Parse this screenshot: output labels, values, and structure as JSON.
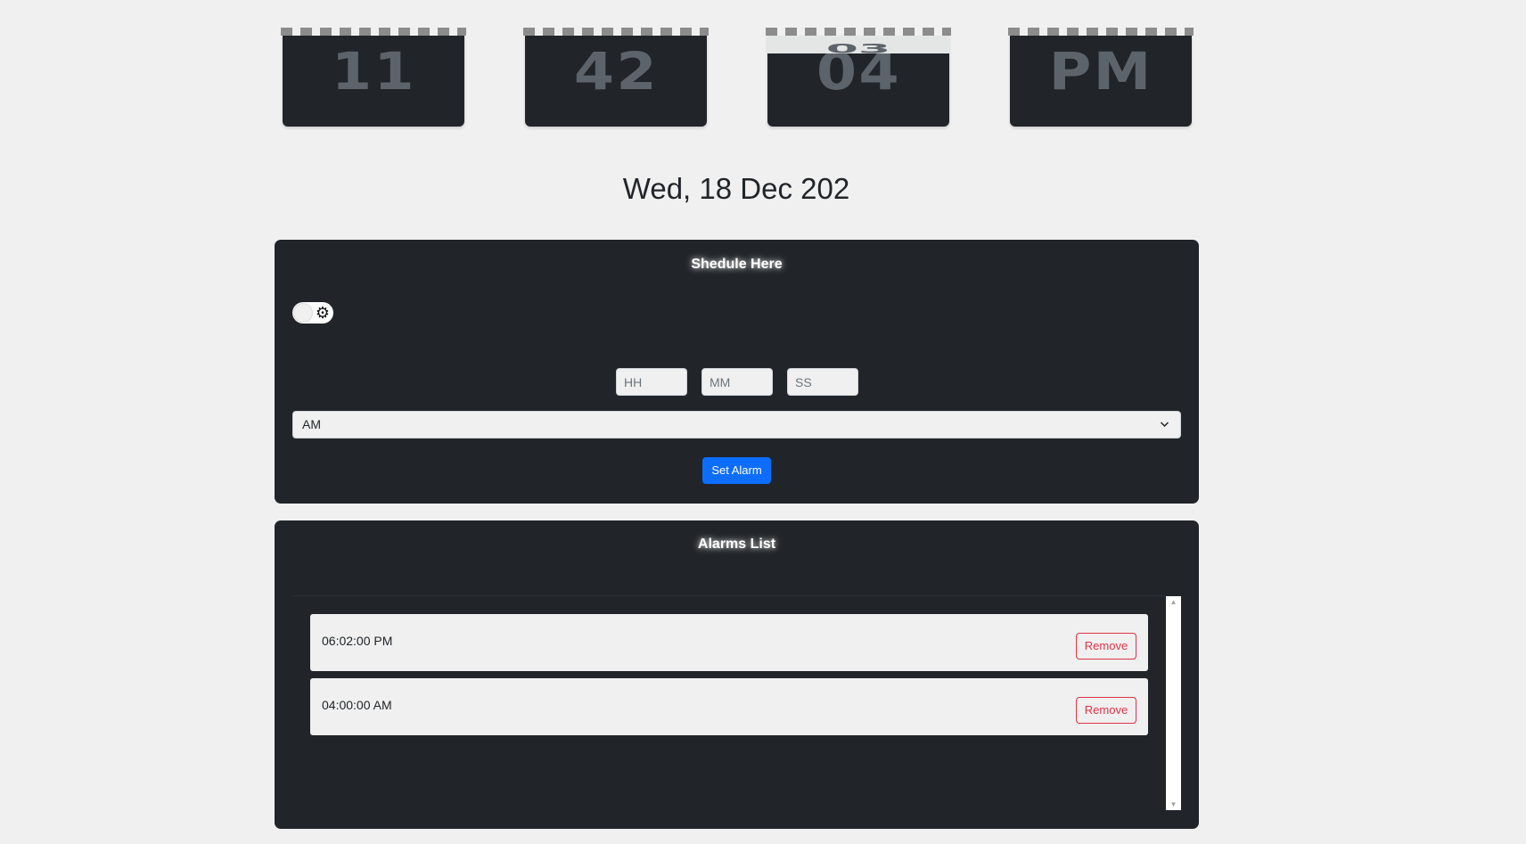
{
  "clock": {
    "hours": "11",
    "minutes": "42",
    "seconds": "04",
    "seconds_flipping": "03",
    "period": "PM"
  },
  "date": "Wed, 18 Dec 202",
  "scheduler": {
    "title": "Shedule Here",
    "toggle_icon": "gear-icon",
    "hours_placeholder": "HH",
    "minutes_placeholder": "MM",
    "seconds_placeholder": "SS",
    "period_selected": "AM",
    "set_button": "Set Alarm"
  },
  "alarms": {
    "title": "Alarms List",
    "items": [
      {
        "time": "06:02:00 PM",
        "remove_label": "Remove"
      },
      {
        "time": "04:00:00 AM",
        "remove_label": "Remove"
      }
    ]
  },
  "colors": {
    "panel": "#212529",
    "primary": "#0d6efd",
    "danger": "#dc3545",
    "digit": "#5c636a"
  }
}
